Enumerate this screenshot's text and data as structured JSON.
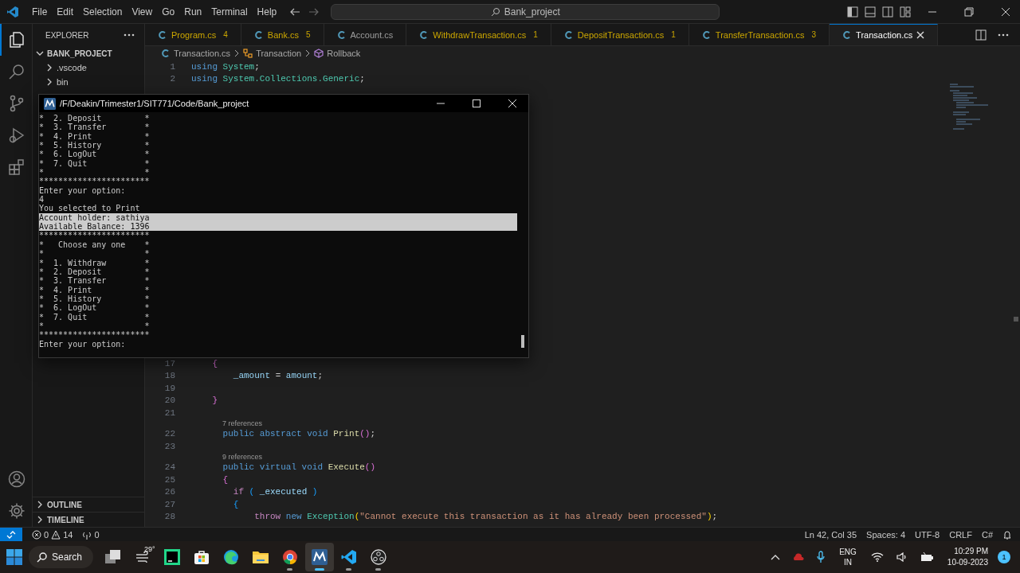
{
  "titlebar": {
    "menus": [
      "File",
      "Edit",
      "Selection",
      "View",
      "Go",
      "Run",
      "Terminal",
      "Help"
    ],
    "search": "Bank_project"
  },
  "activity_bar": {
    "items": [
      {
        "kind": "files",
        "selected": true
      },
      {
        "kind": "search",
        "selected": false
      },
      {
        "kind": "scm",
        "selected": false
      },
      {
        "kind": "debug",
        "selected": false
      },
      {
        "kind": "extensions",
        "selected": false
      }
    ]
  },
  "sidebar": {
    "title": "EXPLORER",
    "tree": [
      {
        "label": "BANK_PROJECT",
        "expanded": true,
        "children": [
          {
            "label": ".vscode",
            "expanded": false
          },
          {
            "label": "bin",
            "expanded": false
          }
        ]
      }
    ],
    "sections": [
      {
        "label": "OUTLINE",
        "expanded": false
      },
      {
        "label": "TIMELINE",
        "expanded": false
      }
    ]
  },
  "tabs": [
    {
      "label": "Program.cs",
      "badge": "4",
      "selected": false
    },
    {
      "label": "Bank.cs",
      "badge": "5",
      "selected": false
    },
    {
      "label": "Account.cs",
      "selected": false
    },
    {
      "label": "WithdrawTransaction.cs",
      "badge": "1",
      "selected": false
    },
    {
      "label": "DepositTransaction.cs",
      "badge": "1",
      "selected": false
    },
    {
      "label": "TransferTransaction.cs",
      "badge": "3",
      "selected": false
    },
    {
      "label": "Transaction.cs",
      "selected": true
    }
  ],
  "breadcrumb": [
    {
      "label": "Transaction.cs",
      "kind": "file"
    },
    {
      "label": "Transaction",
      "kind": "class"
    },
    {
      "label": "Rollback",
      "kind": "method"
    }
  ],
  "code": {
    "top_lines": [
      {
        "n": "1",
        "tokens": [
          {
            "text": "using",
            "kind": "kw"
          },
          {
            "text": " System",
            "kind": "ty"
          },
          {
            "text": ";",
            "kind": "p"
          }
        ]
      },
      {
        "n": "2",
        "tokens": [
          {
            "text": "using",
            "kind": "kw"
          },
          {
            "text": " System.Collections.Generic",
            "kind": "ty"
          },
          {
            "text": ";",
            "kind": "p"
          }
        ]
      }
    ],
    "bottom_lines": [
      {
        "n": "17",
        "tokens": [
          {
            "text": "    {",
            "kind": "b2"
          }
        ]
      },
      {
        "n": "18",
        "tokens": [
          {
            "text": "        _amount",
            "kind": "id"
          },
          {
            "text": " = ",
            "kind": "p"
          },
          {
            "text": "amount",
            "kind": "id"
          },
          {
            "text": ";",
            "kind": "p"
          }
        ]
      },
      {
        "n": "19"
      },
      {
        "n": "20",
        "tokens": [
          {
            "text": "    }",
            "kind": "b2"
          }
        ]
      },
      {
        "n": "21"
      },
      {
        "n": "22",
        "codelens": "7 references",
        "tokens": [
          {
            "text": "      public abstract void",
            "kind": "kw"
          },
          {
            "text": " Print",
            "kind": "fn"
          },
          {
            "text": "()",
            "kind": "b2"
          },
          {
            "text": ";",
            "kind": "p"
          }
        ]
      },
      {
        "n": "23"
      },
      {
        "n": "24",
        "codelens": "9 references",
        "tokens": [
          {
            "text": "      public virtual void",
            "kind": "kw"
          },
          {
            "text": " Execute",
            "kind": "fn"
          },
          {
            "text": "()",
            "kind": "b2"
          }
        ]
      },
      {
        "n": "25",
        "tokens": [
          {
            "text": "      {",
            "kind": "b2"
          }
        ]
      },
      {
        "n": "26",
        "tokens": [
          {
            "text": "        if",
            "kind": "ctl"
          },
          {
            "text": " (",
            "kind": "b3"
          },
          {
            "text": " _executed ",
            "kind": "id"
          },
          {
            "text": ")",
            "kind": "b3"
          }
        ]
      },
      {
        "n": "27",
        "tokens": [
          {
            "text": "        {",
            "kind": "b3"
          }
        ]
      },
      {
        "n": "28",
        "tokens": [
          {
            "text": "            throw",
            "kind": "ctl"
          },
          {
            "text": " new",
            "kind": "kw"
          },
          {
            "text": " Exception",
            "kind": "ty"
          },
          {
            "text": "(",
            "kind": "b1"
          },
          {
            "text": "\"Cannot execute this transaction as it has already been processed\"",
            "kind": "str"
          },
          {
            "text": ")",
            "kind": "b1"
          },
          {
            "text": ";",
            "kind": "p"
          }
        ]
      }
    ]
  },
  "terminal": {
    "title": "/F/Deakin/Trimester1/SIT771/Code/Bank_project",
    "blocks": [
      {
        "text": "*  2. Deposit         *\n*  3. Transfer        *\n*  4. Print           *\n*  5. History         *\n*  6. LogOut          *\n*  7. Quit            *\n*                     *\n***********************\nEnter your option:\n4\nYou selected to Print",
        "selected": false
      },
      {
        "text": "Account holder: sathiya\nAvailable Balance: 1396",
        "selected": true
      },
      {
        "text": "***********************\n*   Choose any one    *\n*                     *\n*  1. Withdraw        *\n*  2. Deposit         *\n*  3. Transfer        *\n*  4. Print           *\n*  5. History         *\n*  6. LogOut          *\n*  7. Quit            *\n*                     *\n***********************\nEnter your option:",
        "selected": false
      }
    ]
  },
  "status_bar": {
    "errors": "0",
    "warnings": "14",
    "ports": "0",
    "right": [
      "Ln 42, Col 35",
      "Spaces: 4",
      "UTF-8",
      "CRLF",
      "C#"
    ]
  },
  "taskbar": {
    "search": "Search",
    "apps": [
      {
        "kind": "taskview",
        "running": false,
        "selected": false
      },
      {
        "kind": "weather",
        "label": "29°",
        "running": false,
        "selected": false
      },
      {
        "kind": "pycharm",
        "running": false,
        "selected": false
      },
      {
        "kind": "store",
        "running": false,
        "selected": false
      },
      {
        "kind": "edge",
        "running": false,
        "selected": false
      },
      {
        "kind": "folder",
        "running": false,
        "selected": false
      },
      {
        "kind": "chrome",
        "running": true,
        "selected": false
      },
      {
        "kind": "terminal",
        "running": true,
        "selected": true
      },
      {
        "kind": "vscode",
        "running": true,
        "selected": false
      },
      {
        "kind": "obs",
        "running": true,
        "selected": false
      }
    ],
    "tray": {
      "language": "ENG",
      "region": "IN",
      "time": "10:29 PM",
      "date": "10-09-2023",
      "notifications": "1"
    }
  }
}
